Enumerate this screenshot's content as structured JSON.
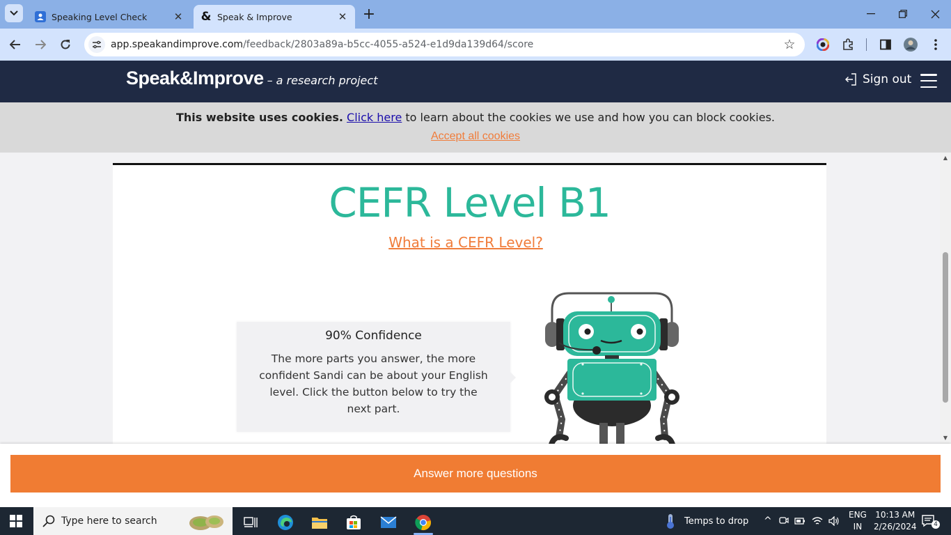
{
  "browser": {
    "tabs": [
      {
        "title": "Speaking Level Check",
        "active": false
      },
      {
        "title": "Speak & Improve",
        "active": true
      }
    ],
    "url_host": "app.speakandimprove.com",
    "url_path": "/feedback/2803a89a-b5cc-4055-a524-e1d9da139d64/score"
  },
  "site": {
    "brand_name": "Speak&Improve",
    "brand_tagline": "– a research project",
    "sign_out": "Sign out"
  },
  "cookies": {
    "bold": "This website uses cookies.",
    "link": "Click here",
    "rest": "to learn about the cookies we use and how you can block cookies.",
    "accept": "Accept all cookies"
  },
  "result": {
    "level_title": "CEFR Level B1",
    "what_link": "What is a CEFR Level?",
    "confidence_title": "90% Confidence",
    "confidence_text": "The more parts you answer, the more confident Sandi can be about your English level. Click the button below to try the next part."
  },
  "cta": {
    "label": "Answer more questions"
  },
  "taskbar": {
    "search_placeholder": "Type here to search",
    "weather": "Temps to drop",
    "lang_top": "ENG",
    "lang_bottom": "IN",
    "time": "10:13 AM",
    "date": "2/26/2024",
    "notifications": "4"
  },
  "colors": {
    "accent_green": "#2cb89a",
    "accent_orange": "#f07c33",
    "header_navy": "#1f2a44"
  }
}
